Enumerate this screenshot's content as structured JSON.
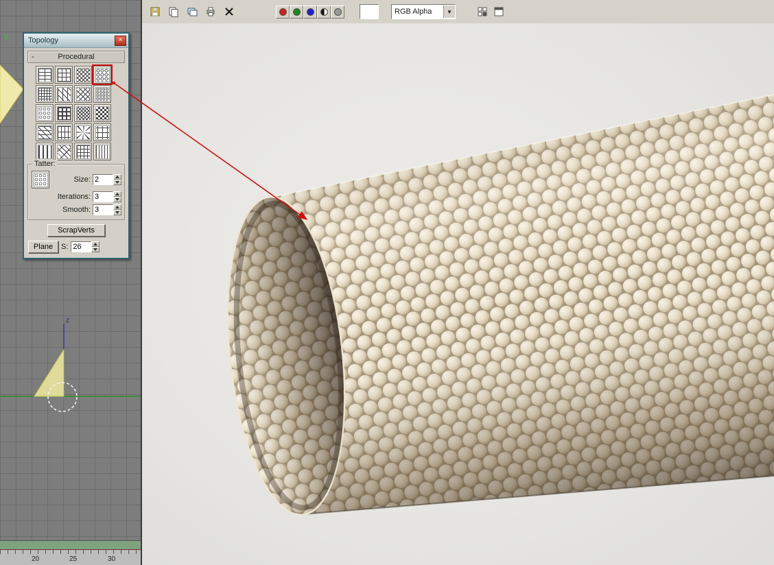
{
  "colors": {
    "accent_red": "#cc1111",
    "ui_gray": "#d6d2ca",
    "viewport_gray": "#7d7d7d",
    "render_bg": "#e8e7e3",
    "bubble_base": "#e3d8c2",
    "channel_red": "#cc2020",
    "channel_green": "#1a8a1a",
    "channel_blue": "#2020cc"
  },
  "render_toolbar": {
    "file_icons": [
      "save-icon",
      "copy-icon",
      "clone-icon",
      "print-icon",
      "delete-icon"
    ],
    "channel_buttons": [
      {
        "name": "red-channel-button",
        "color": "#cc2020",
        "style": "solid"
      },
      {
        "name": "green-channel-button",
        "color": "#1a8a1a",
        "style": "solid"
      },
      {
        "name": "blue-channel-button",
        "color": "#2020cc",
        "style": "solid"
      },
      {
        "name": "alpha-channel-button",
        "color": "#111111",
        "style": "half"
      },
      {
        "name": "mono-channel-button",
        "color": "#9a9a9a",
        "style": "solid"
      }
    ],
    "channel_select_value": "RGB Alpha",
    "dropdown_arrow": "▼",
    "extra_icons": [
      "layers-icon",
      "clone-window-icon"
    ]
  },
  "topology_dialog": {
    "title": "Topology",
    "close_glyph": "×",
    "rollout_label": "Procedural",
    "rollout_collapse": "-",
    "selected_index": 3,
    "patterns": [
      {
        "type": "bricks"
      },
      {
        "type": "offset-bricks"
      },
      {
        "type": "weave"
      },
      {
        "type": "scales"
      },
      {
        "type": "grid-fine"
      },
      {
        "type": "mosaic"
      },
      {
        "type": "diamond"
      },
      {
        "type": "scales-dense"
      },
      {
        "type": "pebbles"
      },
      {
        "type": "basket"
      },
      {
        "type": "crosshatch"
      },
      {
        "type": "checker"
      },
      {
        "type": "triangle"
      },
      {
        "type": "steps"
      },
      {
        "type": "starburst"
      },
      {
        "type": "cross"
      },
      {
        "type": "columns"
      },
      {
        "type": "herringbone"
      },
      {
        "type": "grid"
      },
      {
        "type": "vlines"
      }
    ],
    "tatter": {
      "group_label": "Tatter:",
      "size_label": "Size:",
      "size_value": "2",
      "iterations_label": "Iterations:",
      "iterations_value": "3",
      "smooth_label": "Smooth:",
      "smooth_value": "3"
    },
    "scrapverts_label": "ScrapVerts",
    "plane_label": "Plane",
    "s_label": "S:",
    "s_value": "26"
  },
  "viewport": {
    "y_axis_label": "y",
    "z_axis_label": "z",
    "ruler_numbers": [
      "20",
      "25",
      "30"
    ]
  }
}
